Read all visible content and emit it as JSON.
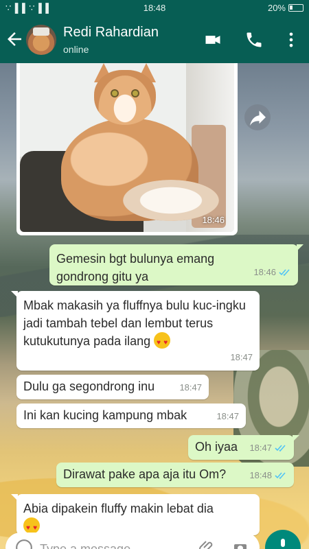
{
  "status_bar": {
    "signal_text": "∵▐▐ ∵▐▐",
    "time": "18:48",
    "battery": "20%"
  },
  "header": {
    "contact_name": "Redi Rahardian",
    "contact_status": "online"
  },
  "image_message": {
    "time": "18:46"
  },
  "messages": [
    {
      "direction": "out",
      "text": "Gemesin bgt bulunya emang gondrong gitu ya",
      "time": "18:46"
    },
    {
      "direction": "in",
      "text": "Mbak makasih ya fluffnya bulu kuc-ingku jadi tambah tebel dan lembut terus kutukutunya pada ilang",
      "time": "18:47"
    },
    {
      "direction": "in",
      "text": "Dulu ga segondrong inu",
      "time": "18:47"
    },
    {
      "direction": "in",
      "text": "Ini kan kucing kampung mbak",
      "time": "18:47"
    },
    {
      "direction": "out",
      "text": "Oh iyaa",
      "time": "18:47"
    },
    {
      "direction": "out",
      "text": "Dirawat pake apa aja itu Om?",
      "time": "18:48"
    },
    {
      "direction": "in",
      "text": "Abia dipakein fluffy makin lebat dia",
      "time": ""
    }
  ],
  "input": {
    "placeholder": "Type a message"
  },
  "colors": {
    "header": "#075e54",
    "outgoing_bubble": "#dcf8c6",
    "incoming_bubble": "#ffffff",
    "read_ticks": "#4fc3f7",
    "mic_button": "#00897b"
  },
  "icons": [
    "back-arrow-icon",
    "video-call-icon",
    "phone-icon",
    "more-vert-icon",
    "share-forward-icon",
    "emoji-icon",
    "attach-icon",
    "camera-icon",
    "mic-icon"
  ]
}
